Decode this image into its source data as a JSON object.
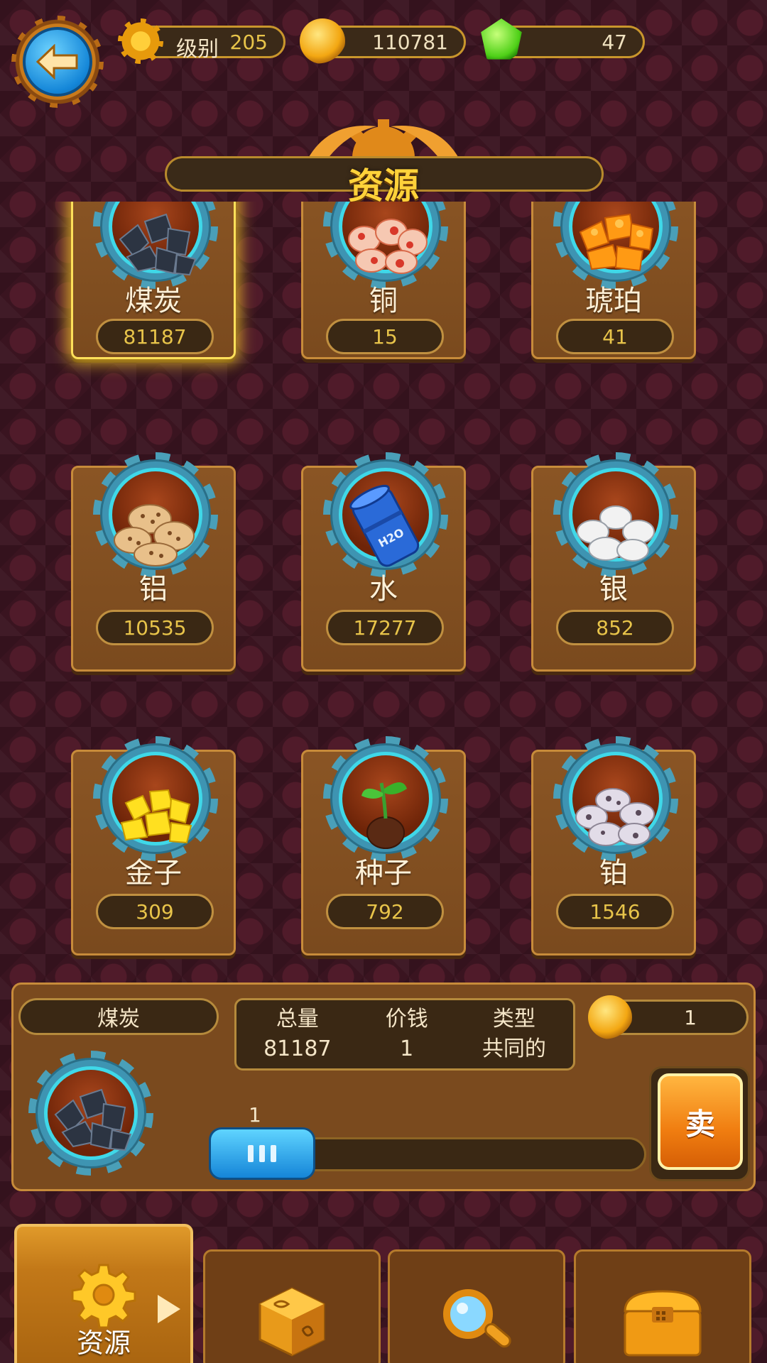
{
  "header": {
    "level_label": "级别",
    "level_value": "205",
    "coins": "110781",
    "gems": "47"
  },
  "title": "资源",
  "resources": [
    {
      "name": "煤炭",
      "count": "81187",
      "icon": "coal-icon",
      "selected": true
    },
    {
      "name": "铜",
      "count": "15",
      "icon": "copper-ore-icon"
    },
    {
      "name": "琥珀",
      "count": "41",
      "icon": "amber-icon"
    },
    {
      "name": "铝",
      "count": "10535",
      "icon": "aluminum-ore-icon"
    },
    {
      "name": "水",
      "count": "17277",
      "icon": "water-barrel-icon"
    },
    {
      "name": "银",
      "count": "852",
      "icon": "silver-ore-icon"
    },
    {
      "name": "金子",
      "count": "309",
      "icon": "gold-nuggets-icon"
    },
    {
      "name": "种子",
      "count": "792",
      "icon": "seed-sprout-icon"
    },
    {
      "name": "铂",
      "count": "1546",
      "icon": "platinum-ore-icon"
    }
  ],
  "detail": {
    "name": "煤炭",
    "total_label": "总量",
    "total_value": "81187",
    "price_label": "价钱",
    "price_value": "1",
    "type_label": "类型",
    "type_value": "共同的",
    "sell_price": "1",
    "quantity": "1",
    "sell_label": "卖"
  },
  "nav": {
    "tabs": [
      {
        "label": "资源",
        "icon": "gear-icon",
        "active": true
      },
      {
        "label": "",
        "icon": "cube-icon"
      },
      {
        "label": "",
        "icon": "magnifier-icon"
      },
      {
        "label": "",
        "icon": "chest-icon"
      }
    ]
  },
  "colors": {
    "background": "#3a1420",
    "card": "#7a4a1e",
    "accent_gold": "#e8c44a",
    "button_blue": "#1585d8",
    "sell_orange": "#f07d10"
  }
}
